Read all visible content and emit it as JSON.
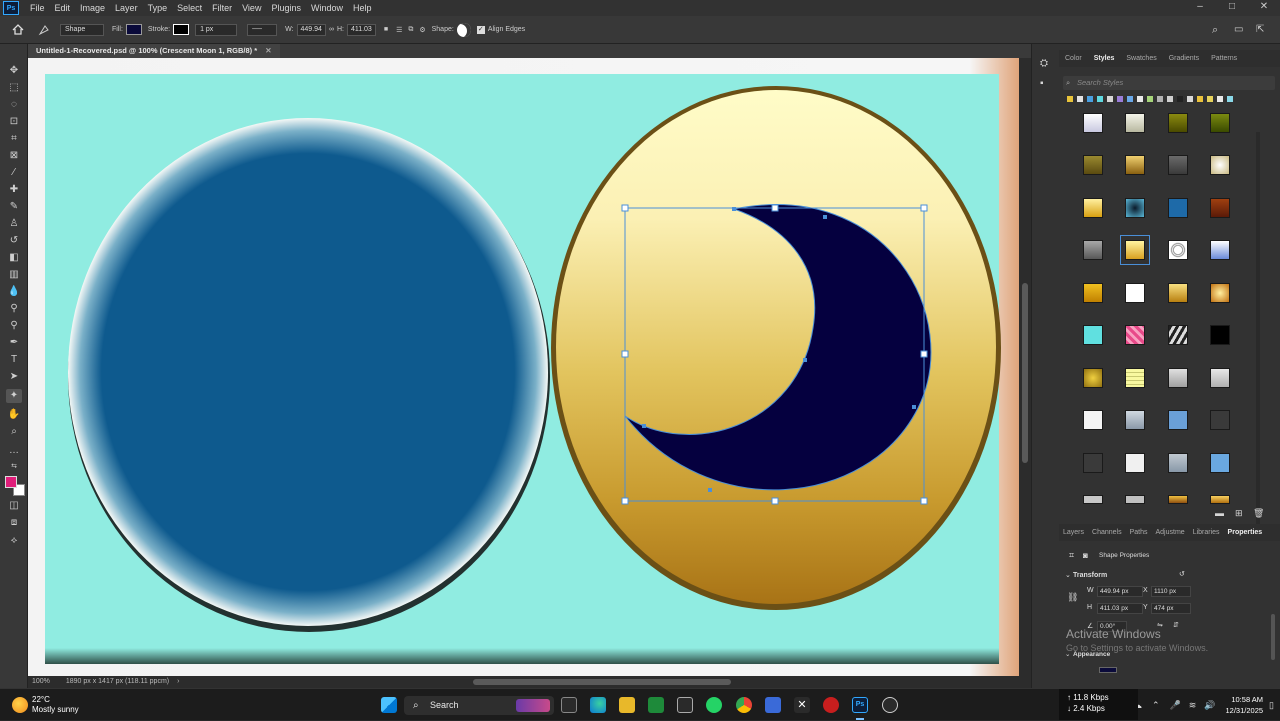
{
  "app": {
    "name": "Ps"
  },
  "menu": [
    "File",
    "Edit",
    "Image",
    "Layer",
    "Type",
    "Select",
    "Filter",
    "View",
    "Plugins",
    "Window",
    "Help"
  ],
  "options_bar": {
    "mode": "Shape",
    "fill_label": "Fill:",
    "fill_color": "#0a0a3a",
    "stroke_label": "Stroke:",
    "stroke_width": "1 px",
    "w_label": "W:",
    "w_value": "449.94",
    "h_label": "H:",
    "h_value": "411.03",
    "shape_label": "Shape:",
    "align_edges": "Align Edges"
  },
  "document": {
    "tab_title": "Untitled-1-Recovered.psd @ 100% (Crescent Moon 1, RGB/8) *",
    "zoom": "100%",
    "dimensions": "1890 px x 1417 px (118.11 ppcm)"
  },
  "styles_panel": {
    "tabs": [
      "Color",
      "Styles",
      "Swatches",
      "Gradients",
      "Patterns"
    ],
    "active_tab": "Styles",
    "search_placeholder": "Search Styles"
  },
  "properties_panel": {
    "tabs": [
      "Layers",
      "Channels",
      "Paths",
      "Adjustme",
      "Libraries",
      "Properties"
    ],
    "active_tab": "Properties",
    "section": "Shape Properties",
    "transform_label": "Transform",
    "w_label": "W",
    "w_value": "449.94 px",
    "x_label": "X",
    "x_value": "1110 px",
    "h_label": "H",
    "h_value": "411.03 px",
    "y_label": "Y",
    "y_value": "474 px",
    "angle_value": "0.00°",
    "appearance_label": "Appearance"
  },
  "watermark": {
    "line1": "Activate Windows",
    "line2": "Go to Settings to activate Windows."
  },
  "taskbar": {
    "temp": "22°C",
    "weather": "Mostly sunny",
    "search": "Search",
    "net_up": "11.8 Kbps",
    "net_down": "2.4 Kbps",
    "time": "10:58 AM",
    "date": "12/31/2025"
  },
  "colors": {
    "canvas_bg": "#90ece1",
    "left_circle": "#0e5a8e",
    "moon": "#05003f",
    "selection": "#4a8fd8",
    "foreground": "#e01e7a",
    "background": "#ffffff"
  }
}
